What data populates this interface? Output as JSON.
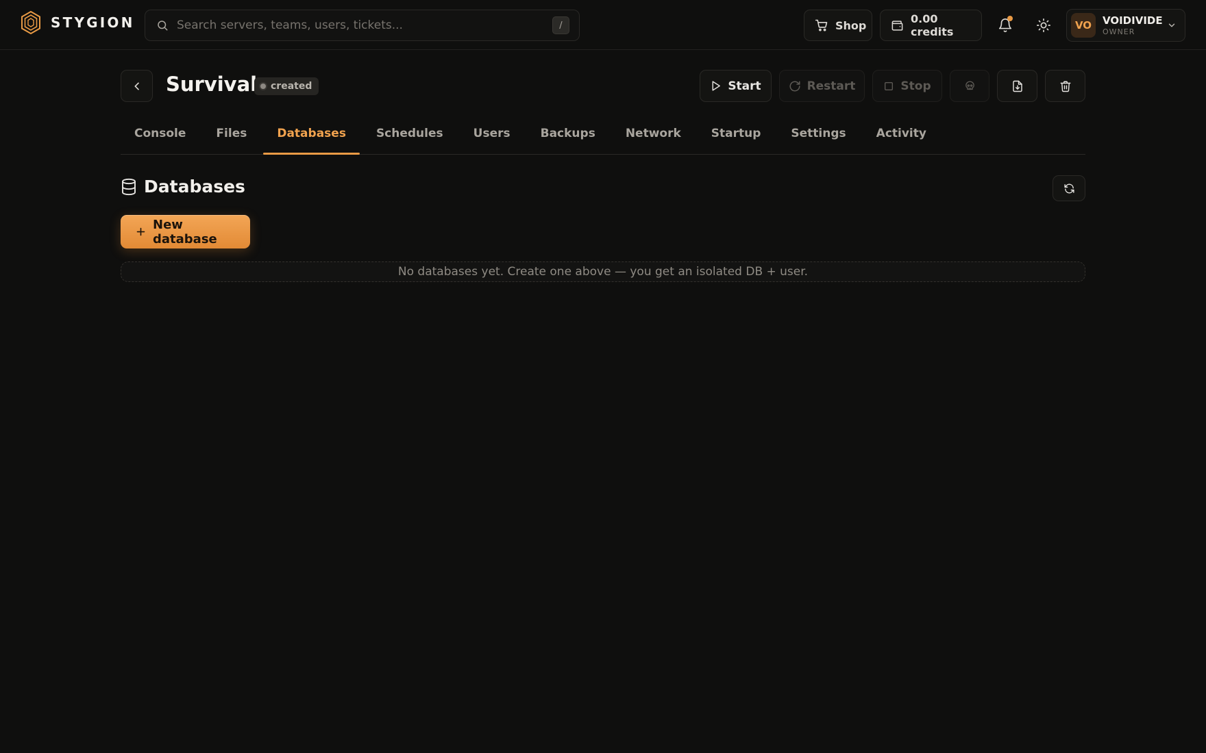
{
  "brand": {
    "name": "STYGION",
    "logo_icon": "hexagon-logo-icon",
    "accent": "#e99a45"
  },
  "search": {
    "placeholder": "Search servers, teams, users, tickets...",
    "shortcut": "/"
  },
  "topbar": {
    "shop_label": "Shop",
    "credits_label": "0.00 credits",
    "has_notification": true,
    "user": {
      "initials": "VO",
      "name": "VOIDIVIDE",
      "role": "OWNER"
    }
  },
  "server": {
    "name": "Survival",
    "status": "created",
    "actions": {
      "start": "Start",
      "restart": "Restart",
      "stop": "Stop"
    }
  },
  "tabs": [
    {
      "label": "Console",
      "active": false
    },
    {
      "label": "Files",
      "active": false
    },
    {
      "label": "Databases",
      "active": true
    },
    {
      "label": "Schedules",
      "active": false
    },
    {
      "label": "Users",
      "active": false
    },
    {
      "label": "Backups",
      "active": false
    },
    {
      "label": "Network",
      "active": false
    },
    {
      "label": "Startup",
      "active": false
    },
    {
      "label": "Settings",
      "active": false
    },
    {
      "label": "Activity",
      "active": false
    }
  ],
  "databases": {
    "title": "Databases",
    "new_button": "New database",
    "empty_message": "No databases yet. Create one above — you get an isolated DB + user."
  }
}
